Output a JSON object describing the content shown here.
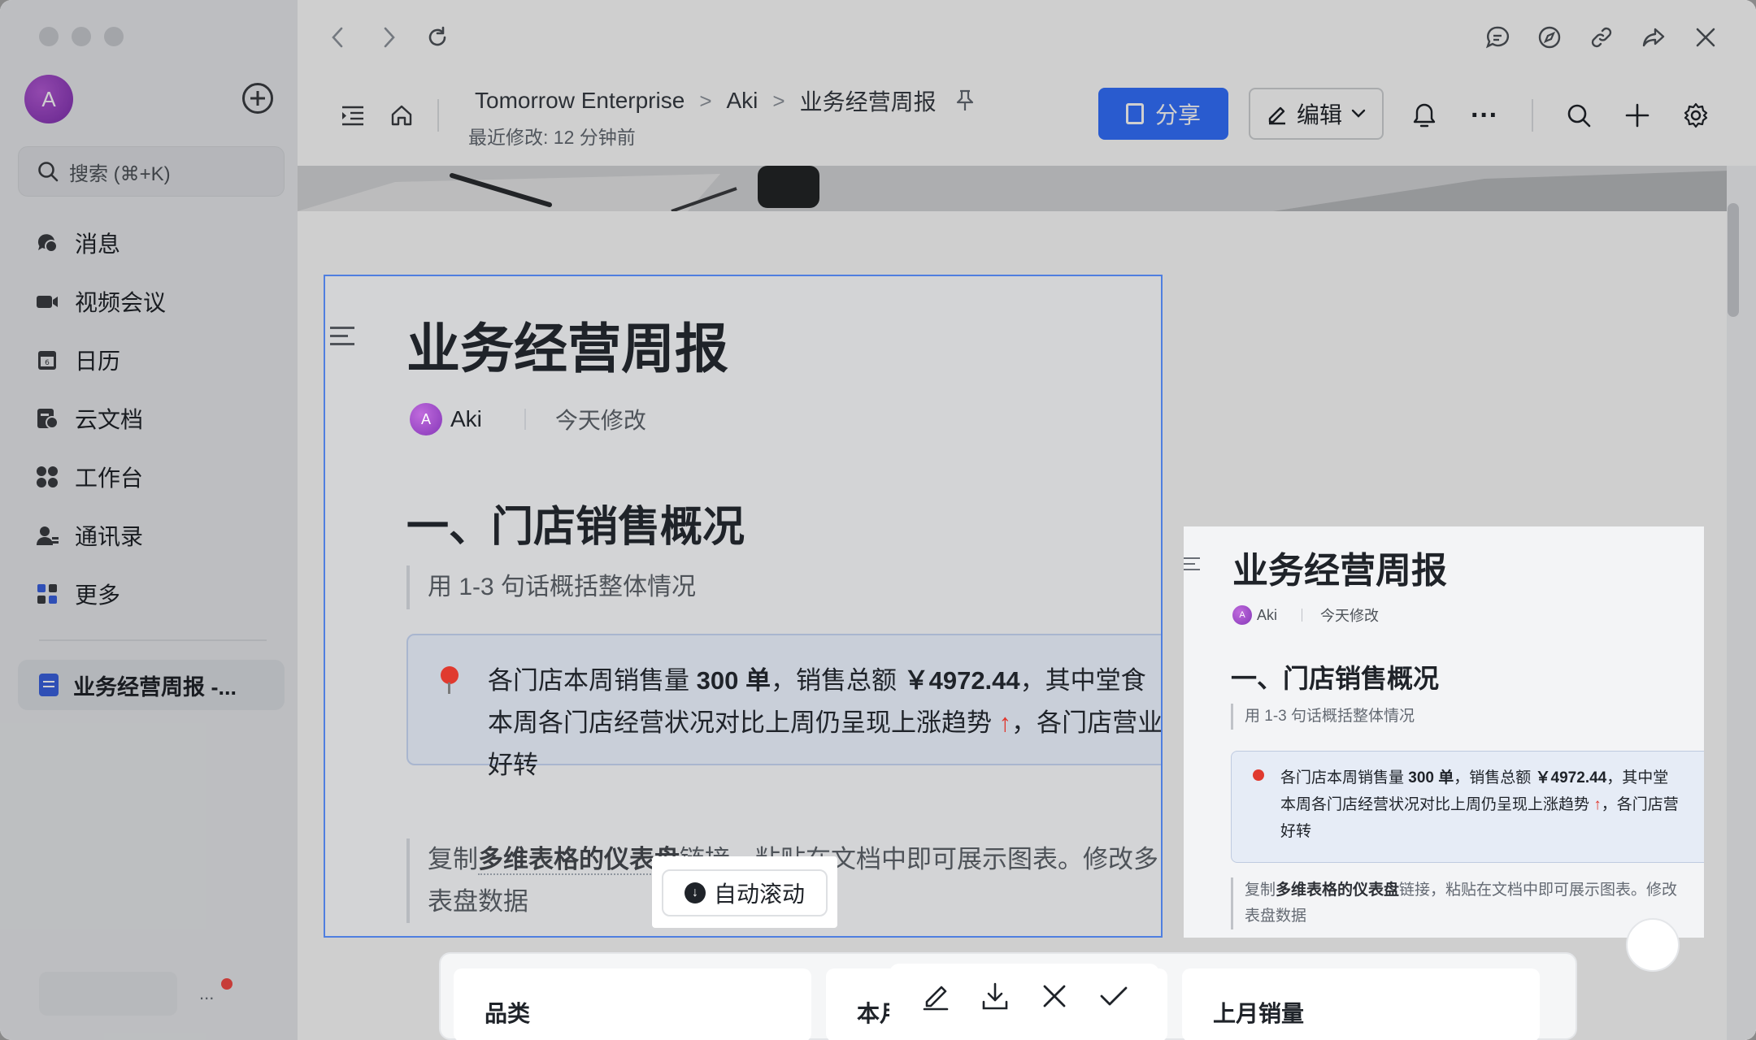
{
  "sidebar": {
    "avatar_initial": "A",
    "search_placeholder": "搜索 (⌘+K)",
    "items": [
      {
        "label": "消息",
        "icon": "message-icon"
      },
      {
        "label": "视频会议",
        "icon": "video-icon"
      },
      {
        "label": "日历",
        "icon": "calendar-icon"
      },
      {
        "label": "云文档",
        "icon": "cloud-doc-icon"
      },
      {
        "label": "工作台",
        "icon": "workspace-icon"
      },
      {
        "label": "通讯录",
        "icon": "contacts-icon"
      },
      {
        "label": "更多",
        "icon": "more-apps-icon"
      }
    ],
    "open_doc_label": "业务经营周报 -...",
    "more_label": "..."
  },
  "header": {
    "breadcrumb": [
      "Tomorrow Enterprise",
      "Aki",
      "业务经营周报"
    ],
    "last_modified": "最近修改: 12 分钟前",
    "share_label": "分享",
    "edit_label": "编辑",
    "more_label": "···"
  },
  "document": {
    "title": "业务经营周报",
    "author_initial": "A",
    "author": "Aki",
    "modified": "今天修改",
    "section1_heading": "一、门店销售概况",
    "section1_hint": "用 1-3 句话概括整体情况",
    "callout": {
      "line1_a": "各门店本周销售量 ",
      "line1_b": "300 单",
      "line1_c": "，销售总额 ",
      "line1_d": "￥4972.44",
      "line1_e": "，其中堂食",
      "line2_a": "本周各门店经营状况对比上周仍呈现上涨趋势 ",
      "line2_arrow": "↑",
      "line2_b": "，各门店营业",
      "line3": "好转"
    },
    "tip_a": "复制",
    "tip_b": "多维表格的仪表盘",
    "tip_c": "链接，粘贴在文档中即可展示图表。修改多",
    "tip_line2": "表盘数据",
    "table_headers": [
      "品类",
      "本月",
      "上月销量"
    ]
  },
  "preview": {
    "title": "业务经营周报",
    "author_initial": "A",
    "author": "Aki",
    "modified": "今天修改",
    "section1_heading": "一、门店销售概况",
    "section1_hint": "用 1-3 句话概括整体情况",
    "line1_a": "各门店本周销售量 ",
    "line1_b": "300 单",
    "line1_c": "，销售总额 ",
    "line1_d": "￥4972.44",
    "line1_e": "，其中堂",
    "line2_a": "本周各门店经营状况对比上周仍呈现上涨趋势 ",
    "line2_arrow": "↑",
    "line2_b": "，各门店营",
    "line3": "好转",
    "tip_a": "复制",
    "tip_b": "多维表格的仪表盘",
    "tip_c": "链接，粘贴在文档中即可展示图表。修改",
    "tip_line2": "表盘数据"
  },
  "capture": {
    "auto_scroll_label": "自动滚动"
  },
  "colors": {
    "accent": "#3370ff",
    "selection_border": "#4f7fe0",
    "arrow_up": "#e0352b",
    "notification": "#f54a45"
  }
}
